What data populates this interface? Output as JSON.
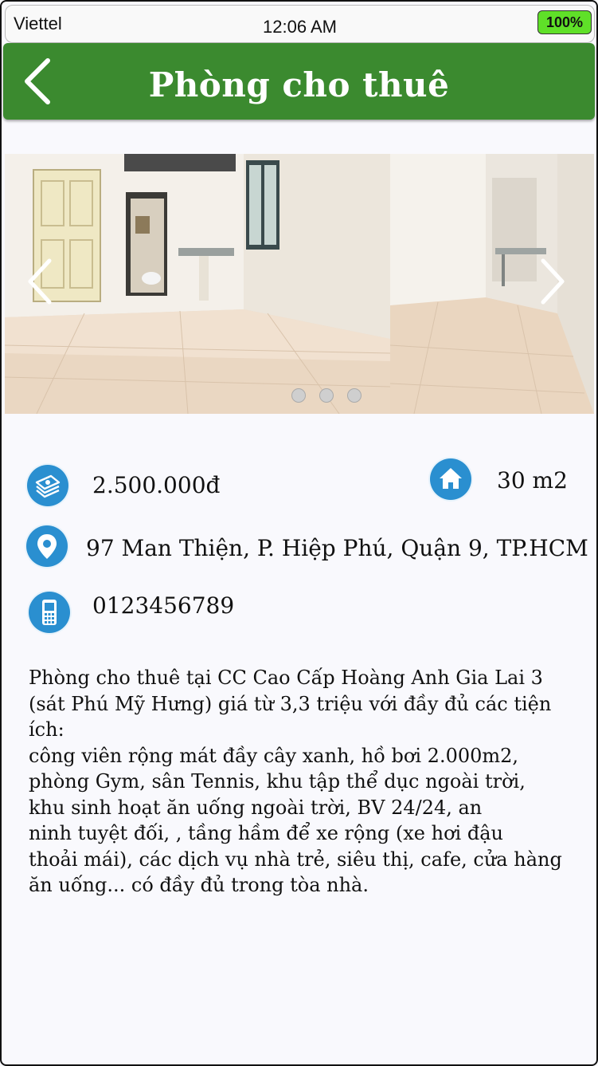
{
  "status_bar": {
    "carrier": "Viettel",
    "time": "12:06 AM",
    "battery": "100%"
  },
  "nav": {
    "title": "Phòng cho thuê",
    "back_icon": "chevron-left-icon"
  },
  "gallery": {
    "prev_icon": "chevron-left-icon",
    "next_icon": "chevron-right-icon",
    "photo_count": 3
  },
  "info": {
    "price": "2.500.000đ",
    "price_icon": "money-stack-icon",
    "area": "30 m2",
    "area_icon": "home-icon",
    "address": "97 Man Thiện, P. Hiệp Phú, Quận 9, TP.HCM",
    "address_icon": "location-pin-icon",
    "phone": "0123456789",
    "phone_icon": "mobile-phone-icon"
  },
  "description": {
    "lines": [
      "Phòng cho thuê tại CC Cao Cấp Hoàng Anh Gia Lai 3",
      "(sát Phú Mỹ Hưng) giá từ 3,3 triệu với đầy đủ các tiện ích:",
      "công viên rộng mát đầy cây xanh, hồ bơi 2.000m2,",
      "phòng Gym, sân Tennis, khu tập thể dục ngoài trời,",
      "khu sinh hoạt ăn uống ngoài trời, BV 24/24, an",
      "ninh tuyệt đối, , tầng hầm để xe rộng (xe hơi đậu",
      "thoải mái), các dịch vụ nhà trẻ, siêu thị, cafe, cửa hàng",
      "ăn uống... có đầy đủ trong tòa nhà."
    ]
  },
  "colors": {
    "nav_green": "#3b8a2f",
    "icon_blue": "#2a8fd0",
    "battery_green": "#5fe028"
  }
}
